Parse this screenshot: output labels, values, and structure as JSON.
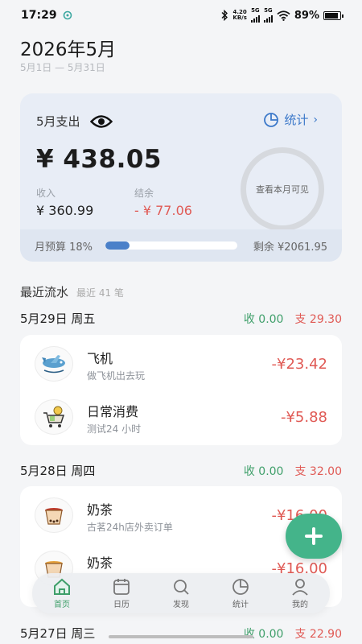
{
  "status": {
    "time": "17:29",
    "speed_value": "4.20",
    "speed_unit": "KB/s",
    "net1": "5G",
    "net2": "5G",
    "battery": "89%",
    "battery_level": 0.89
  },
  "header": {
    "title": "2026年5月",
    "range": "5月1日 — 5月31日"
  },
  "summary": {
    "label": "5月支出",
    "stats_link": "统计",
    "stats_chevron": "›",
    "total": "¥ 438.05",
    "income_label": "收入",
    "income_value": "¥ 360.99",
    "balance_label": "结余",
    "balance_value": "- ¥ 77.06",
    "ring_text": "查看本月可见",
    "budget_label": "月预算 18%",
    "budget_fraction": 0.18,
    "remaining": "剩余 ¥2061.95"
  },
  "recent": {
    "title": "最近流水",
    "count": "最近 41 笔"
  },
  "days": [
    {
      "date": "5月29日 周五",
      "income": "收 0.00",
      "expense": "支 29.30",
      "items": [
        {
          "name": "飞机",
          "note": "做飞机出去玩",
          "amount": "-¥23.42",
          "icon": "airplane-icon"
        },
        {
          "name": "日常消费",
          "note": "测试24 小时",
          "amount": "-¥5.88",
          "icon": "shopping-cart-icon"
        }
      ]
    },
    {
      "date": "5月28日 周四",
      "income": "收 0.00",
      "expense": "支 32.00",
      "items": [
        {
          "name": "奶茶",
          "note": "古茗24h店外卖订单",
          "amount": "-¥16.00",
          "icon": "milk-tea-icon"
        },
        {
          "name": "奶茶",
          "note": "",
          "amount": "-¥16.00",
          "icon": "milk-tea-icon"
        }
      ]
    },
    {
      "date": "5月27日 周三",
      "income": "收 0.00",
      "expense": "支 22.90",
      "items": []
    }
  ],
  "nav": [
    {
      "label": "首页",
      "icon": "home-icon",
      "active": true
    },
    {
      "label": "日历",
      "icon": "calendar-icon",
      "active": false
    },
    {
      "label": "发现",
      "icon": "search-icon",
      "active": false
    },
    {
      "label": "统计",
      "icon": "pie-chart-icon",
      "active": false
    },
    {
      "label": "我的",
      "icon": "user-icon",
      "active": false
    }
  ],
  "colors": {
    "accent_green": "#44b48a",
    "expense_red": "#e05a55",
    "income_green": "#3f9f6a",
    "link_blue": "#3b78c9"
  }
}
